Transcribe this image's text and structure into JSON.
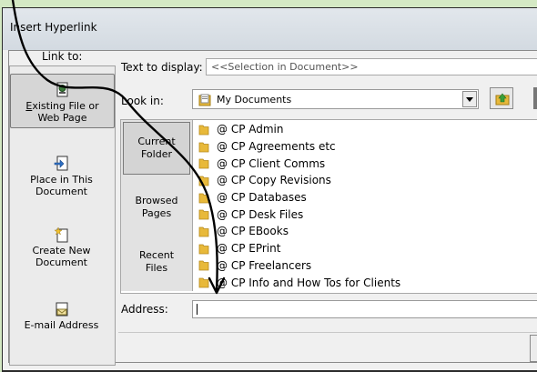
{
  "dialog": {
    "title": "Insert Hyperlink",
    "link_to_label": "Link to:",
    "text_to_display_label": "Text to display:",
    "text_to_display_value": "<<Selection in Document>>",
    "look_in_label": "Look in:",
    "look_in_value": "My Documents",
    "address_label": "Address:",
    "address_value": ""
  },
  "sidebar": {
    "items": [
      {
        "line1": "Existing File or",
        "line2": "Web Page",
        "icon": "existing-file-icon",
        "active": true
      },
      {
        "line1": "Place in This",
        "line2": "Document",
        "icon": "place-in-document-icon",
        "active": false
      },
      {
        "line1": "Create New",
        "line2": "Document",
        "icon": "create-new-document-icon",
        "active": false
      },
      {
        "line1": "E-mail Address",
        "line2": "",
        "icon": "email-address-icon",
        "active": false
      }
    ]
  },
  "locations": [
    {
      "line1": "Current",
      "line2": "Folder",
      "active": true
    },
    {
      "line1": "Browsed",
      "line2": "Pages",
      "active": false
    },
    {
      "line1": "Recent",
      "line2": "Files",
      "active": false
    }
  ],
  "folders": [
    "@ CP Admin",
    "@ CP Agreements etc",
    "@ CP Client Comms",
    "@ CP Copy Revisions",
    "@ CP Databases",
    "@ CP Desk Files",
    "@ CP EBooks",
    "@ CP EPrint",
    "@ CP Freelancers",
    "@ CP Info and How Tos for Clients"
  ],
  "colors": {
    "folder": "#e8b93a",
    "background": "#d4e9c4",
    "annotation_arrow": "#000000"
  }
}
